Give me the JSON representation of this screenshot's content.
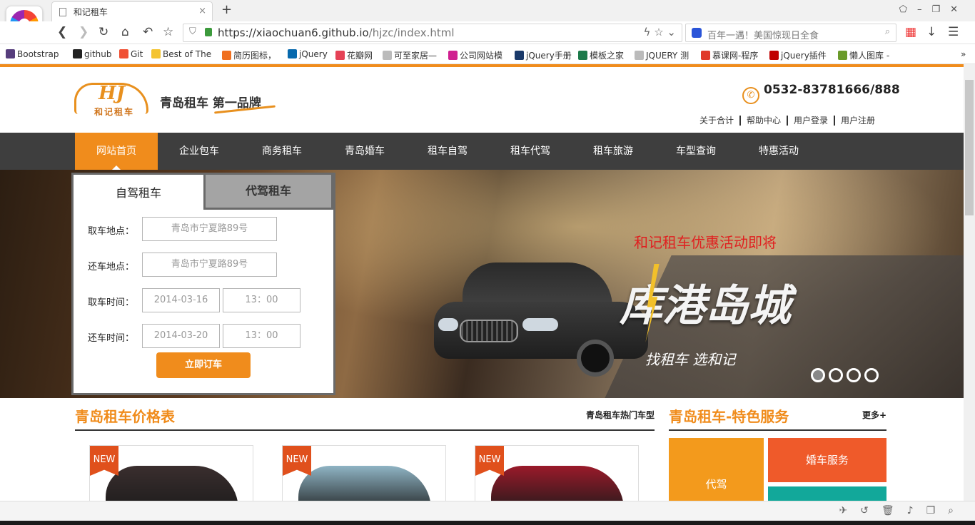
{
  "browser": {
    "tab_title": "和记租车",
    "tab_close": "×",
    "new_tab": "+",
    "url_host": "https://xiaochuan6.github.io",
    "url_path": "/hjzc/index.html",
    "search_placeholder": "百年一遇！美国惊现日全食",
    "bookmarks": [
      {
        "label": "Bootstrap",
        "icon": "bootstrap-icon",
        "color": "#563d7c"
      },
      {
        "label": "github",
        "icon": "github-icon",
        "color": "#222222"
      },
      {
        "label": "Git",
        "icon": "git-icon",
        "color": "#f05033"
      },
      {
        "label": "Best of The",
        "icon": "star-icon",
        "color": "#f4c430"
      },
      {
        "label": "简历图标，",
        "icon": "resume-icon",
        "color": "#f07020"
      },
      {
        "label": "jQuery",
        "icon": "jquery-icon",
        "color": "#0769ad"
      },
      {
        "label": "花瓣网",
        "icon": "huaban-icon",
        "color": "#e54256"
      },
      {
        "label": "可至家居—",
        "icon": "page-icon",
        "color": "#bbbbbb"
      },
      {
        "label": "公司网站模",
        "icon": "ku-icon",
        "color": "#d02090"
      },
      {
        "label": "jQuery手册",
        "icon": "jquery-manual-icon",
        "color": "#1a3a6a"
      },
      {
        "label": "模板之家",
        "icon": "moban-icon",
        "color": "#1c7a4a"
      },
      {
        "label": "JQUERY 测",
        "icon": "page-icon",
        "color": "#bbbbbb"
      },
      {
        "label": "慕课网-程序",
        "icon": "imooc-icon",
        "color": "#e03a2a"
      },
      {
        "label": "jQuery插件",
        "icon": "jquery-plugin-icon",
        "color": "#c00000"
      },
      {
        "label": "懒人图库 -",
        "icon": "lanren-icon",
        "color": "#6a9a2a"
      }
    ]
  },
  "site": {
    "logo_letters": "HJ",
    "logo_cn": "和记租车",
    "slogan": "青岛租车 第一品牌",
    "phone": "0532-83781666/888",
    "top_links": [
      "关于合计",
      "帮助中心",
      "用户登录",
      "用户注册"
    ],
    "nav": [
      "网站首页",
      "企业包车",
      "商务租车",
      "青岛婚车",
      "租车自驾",
      "租车代驾",
      "租车旅游",
      "车型查询",
      "特惠活动"
    ],
    "accent": "#f08c1c"
  },
  "banner": {
    "promo": "和记租车优惠活动即将",
    "title": "库港岛城",
    "tagline": "找租车 选和记",
    "slides": 4,
    "active_slide": 1
  },
  "booking": {
    "tab_active": "自驾租车",
    "tab_other": "代驾租车",
    "pickup_label": "取车地点：",
    "pickup_placeholder": "青岛市宁夏路89号",
    "return_label": "还车地点：",
    "return_placeholder": "青岛市宁夏路89号",
    "pickup_time_label": "取车时间：",
    "pickup_date": "2014-03-16",
    "pickup_hour": "13：00",
    "return_time_label": "还车时间：",
    "return_date": "2014-03-20",
    "return_hour": "13：00",
    "submit": "立即订车"
  },
  "price_section": {
    "title": "青岛租车价格表",
    "link": "青岛租车热门车型",
    "badge": "NEW",
    "cars": [
      {
        "color": "#3a2e2e"
      },
      {
        "color": "#8fb4c4"
      },
      {
        "color": "#9a1a2a"
      }
    ]
  },
  "service_section": {
    "title": "青岛租车-特色服务",
    "more": "更多+",
    "tiles": [
      {
        "label": "代驾",
        "color": "#f39a1c"
      },
      {
        "label": "婚车服务",
        "color": "#ef5a2a"
      },
      {
        "label": "",
        "color": "#12a89a"
      }
    ]
  }
}
